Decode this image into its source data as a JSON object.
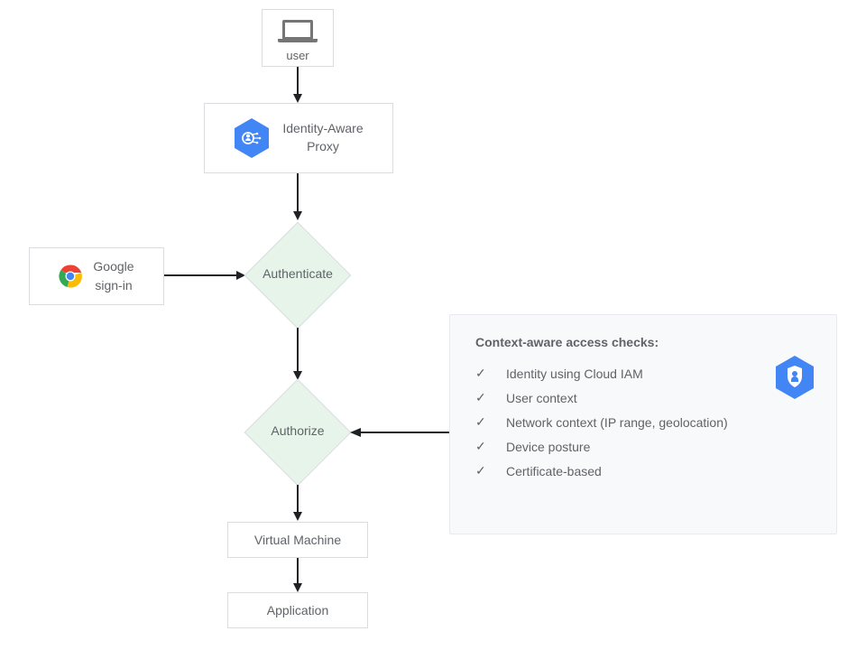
{
  "nodes": {
    "user": "user",
    "iap": "Identity-Aware\nProxy",
    "signin_line1": "Google",
    "signin_line2": "sign-in",
    "authenticate": "Authenticate",
    "authorize": "Authorize",
    "vm": "Virtual Machine",
    "app": "Application"
  },
  "checks": {
    "title": "Context-aware access checks:",
    "items": [
      "Identity using Cloud IAM",
      "User context",
      "Network context (IP range, geolocation)",
      "Device posture",
      "Certificate-based"
    ]
  },
  "icons": {
    "laptop": "laptop-icon",
    "iap": "iap-hex-icon",
    "chrome": "chrome-icon",
    "security": "security-hex-icon"
  }
}
